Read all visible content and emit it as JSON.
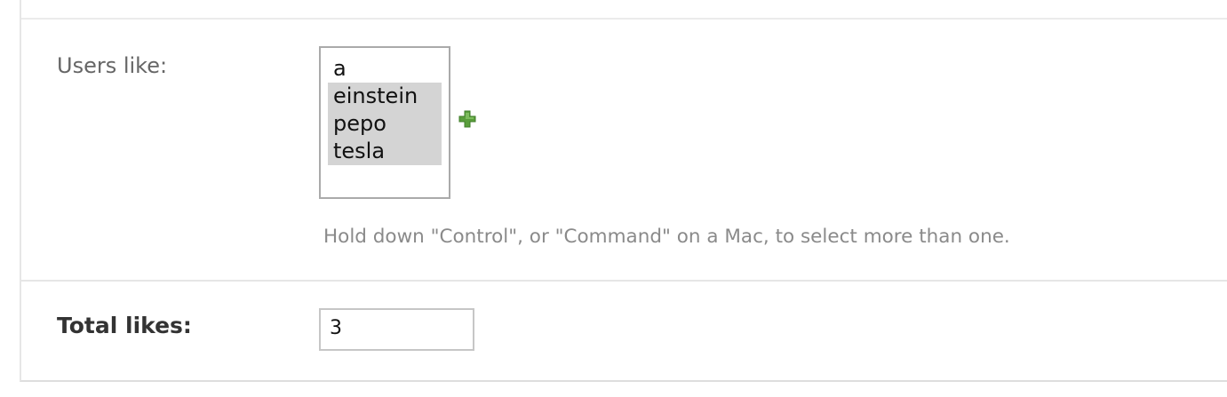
{
  "users_like": {
    "label": "Users like:",
    "options": [
      {
        "text": "a",
        "selected": false
      },
      {
        "text": "einstein",
        "selected": true
      },
      {
        "text": "pepo",
        "selected": true
      },
      {
        "text": "tesla",
        "selected": true
      }
    ],
    "add_icon": "plus-icon",
    "help_text": "Hold down \"Control\", or \"Command\" on a Mac, to select more than one."
  },
  "total_likes": {
    "label": "Total likes:",
    "value": "3"
  },
  "colors": {
    "add_icon": "#5a9e3c",
    "selected_bg": "#d4d4d4",
    "help_text": "#8a8a8a"
  }
}
